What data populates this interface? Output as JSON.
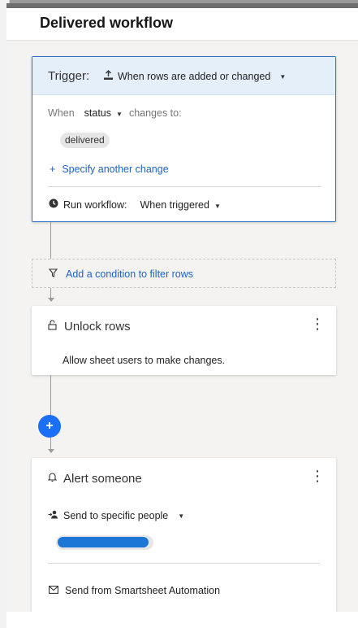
{
  "header": {
    "title": "Delivered workflow"
  },
  "trigger": {
    "label": "Trigger:",
    "selected": "When rows are added or changed",
    "when_label": "When",
    "field": "status",
    "changes_to": "changes to:",
    "value_chip": "delivered",
    "specify_link": "Specify another change",
    "run_label": "Run workflow:",
    "run_value": "When triggered"
  },
  "condition": {
    "link": "Add a condition to filter rows"
  },
  "unlock": {
    "title": "Unlock rows",
    "description": "Allow sheet users to make changes."
  },
  "add_step": {
    "symbol": "+"
  },
  "alert": {
    "title": "Alert someone",
    "send_to": "Send to specific people",
    "from": "Send from Smartsheet Automation"
  },
  "colors": {
    "accent": "#2162c4",
    "trigger_bg": "#e4effa",
    "plus_button": "#1a6ff5"
  },
  "icons": {
    "trigger": "row-upload-icon",
    "run": "clock-icon",
    "filter": "filter-icon",
    "unlock": "unlock-icon",
    "alert": "bell-icon",
    "send_to": "person-add-icon",
    "from": "envelope-icon"
  }
}
